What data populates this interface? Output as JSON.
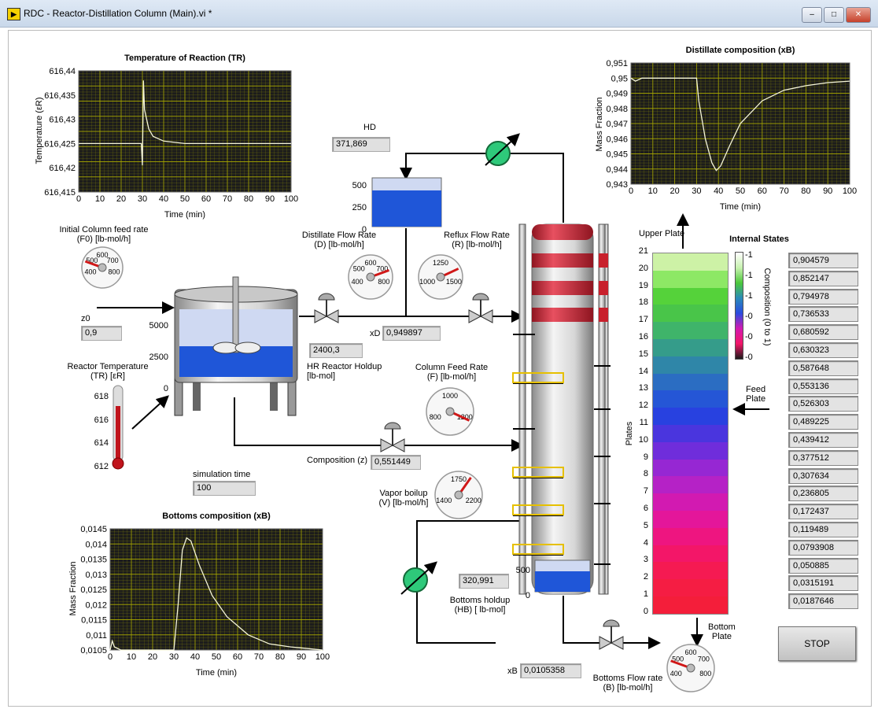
{
  "window": {
    "title": "RDC - Reactor-Distillation Column (Main).vi *",
    "icon_text": "▶",
    "minimize": "–",
    "maximize": "□",
    "close": "✕"
  },
  "charts": {
    "tr": {
      "title": "Temperature of Reaction (TR)",
      "ylabel": "Temperature (εR)",
      "xlabel": "Time (min)",
      "yticks": [
        "616,44",
        "616,435",
        "616,43",
        "616,425",
        "616,42",
        "616,415"
      ],
      "xticks": [
        "0",
        "10",
        "20",
        "30",
        "40",
        "50",
        "60",
        "70",
        "80",
        "90",
        "100"
      ]
    },
    "xd": {
      "title": "Distillate composition (xB)",
      "ylabel": "Mass Fraction",
      "xlabel": "Time (min)",
      "yticks": [
        "0,951",
        "0,95",
        "0,949",
        "0,948",
        "0,947",
        "0,946",
        "0,945",
        "0,944",
        "0,943"
      ],
      "xticks": [
        "0",
        "10",
        "20",
        "30",
        "40",
        "50",
        "60",
        "70",
        "80",
        "90",
        "100"
      ]
    },
    "xb": {
      "title": "Bottoms composition (xB)",
      "ylabel": "Mass Fraction",
      "xlabel": "Time (min)",
      "yticks": [
        "0,0145",
        "0,014",
        "0,0135",
        "0,013",
        "0,0125",
        "0,012",
        "0,0115",
        "0,011",
        "0,0105"
      ],
      "xticks": [
        "0",
        "10",
        "20",
        "30",
        "40",
        "50",
        "60",
        "70",
        "80",
        "90",
        "100"
      ]
    }
  },
  "chart_data": [
    {
      "type": "line",
      "title": "Temperature of Reaction (TR)",
      "xlabel": "Time (min)",
      "ylabel": "Temperature (εR)",
      "xlim": [
        0,
        100
      ],
      "ylim": [
        616.415,
        616.44
      ],
      "grid": true,
      "series": [
        {
          "x": [
            0,
            10,
            20,
            29.5,
            30,
            30.5,
            31,
            33,
            35,
            40,
            50,
            60,
            70,
            80,
            90,
            100
          ],
          "values": [
            616.425,
            616.425,
            616.425,
            616.425,
            616.4205,
            616.438,
            616.432,
            616.428,
            616.4265,
            616.4255,
            616.425,
            616.425,
            616.425,
            616.425,
            616.425,
            616.425
          ]
        }
      ]
    },
    {
      "type": "line",
      "title": "Distillate composition (xB)",
      "xlabel": "Time (min)",
      "ylabel": "Mass Fraction",
      "xlim": [
        0,
        100
      ],
      "ylim": [
        0.943,
        0.951
      ],
      "grid": true,
      "series": [
        {
          "x": [
            0,
            2,
            5,
            10,
            20,
            30,
            31,
            34,
            37,
            39,
            41,
            45,
            50,
            60,
            70,
            80,
            90,
            100
          ],
          "values": [
            0.95,
            0.9498,
            0.95,
            0.95,
            0.95,
            0.95,
            0.9485,
            0.946,
            0.9444,
            0.9439,
            0.9442,
            0.9455,
            0.947,
            0.9485,
            0.9492,
            0.9495,
            0.9497,
            0.9498
          ]
        }
      ]
    },
    {
      "type": "line",
      "title": "Bottoms composition (xB)",
      "xlabel": "Time (min)",
      "ylabel": "Mass Fraction",
      "xlim": [
        0,
        100
      ],
      "ylim": [
        0.0105,
        0.0145
      ],
      "grid": true,
      "series": [
        {
          "x": [
            0,
            1,
            2,
            5,
            10,
            20,
            30,
            32,
            34,
            36,
            38,
            42,
            48,
            55,
            65,
            75,
            85,
            100
          ],
          "values": [
            0.0105,
            0.0108,
            0.0106,
            0.0105,
            0.0105,
            0.0105,
            0.0105,
            0.012,
            0.0138,
            0.0142,
            0.0141,
            0.0133,
            0.0123,
            0.0116,
            0.011,
            0.0107,
            0.0106,
            0.0105
          ]
        }
      ]
    }
  ],
  "indicators": {
    "hd": {
      "label": "HD",
      "value": "371,869"
    },
    "z0": {
      "label": "z0",
      "value": "0,9"
    },
    "xd": {
      "label": "xD",
      "value": "0,949897"
    },
    "reactor_holdup": {
      "label": "HR Reactor Holdup\n[lb-mol]",
      "value": "2400,3"
    },
    "composition_z": {
      "label": "Composition (z)",
      "value": "0,551449"
    },
    "sim_time": {
      "label": "simulation time",
      "value": "100"
    },
    "bottoms_holdup": {
      "label": "Bottoms holdup\n(HB) [ lb-mol]",
      "value": "320,991"
    },
    "xb": {
      "label": "xB",
      "value": "0,0105358"
    }
  },
  "gauges": {
    "f0": {
      "label": "Initial Column feed rate\n(F0) [lb-mol/h]",
      "ticks": [
        "400",
        "500",
        "600",
        "700",
        "800"
      ]
    },
    "d": {
      "label": "Distillate Flow Rate\n(D) [lb-mol/h]",
      "ticks": [
        "400",
        "500",
        "600",
        "700",
        "800"
      ]
    },
    "r": {
      "label": "Reflux Flow Rate\n(R) [lb-mol/h]",
      "ticks": [
        "1000",
        "1250",
        "1500"
      ]
    },
    "f": {
      "label": "Column Feed Rate\n(F) [lb-mol/h]",
      "ticks": [
        "800",
        "1000",
        "1200"
      ]
    },
    "v": {
      "label": "Vapor boilup\n(V) [lb-mol/h]",
      "ticks": [
        "1400",
        "1750",
        "2200"
      ]
    },
    "b": {
      "label": "Bottoms Flow rate\n(B) [lb-mol/h]",
      "ticks": [
        "400",
        "500",
        "600",
        "700",
        "800"
      ]
    }
  },
  "tanks": {
    "distillate": {
      "ticks": [
        "500",
        "250",
        "0"
      ],
      "level": 0.74
    },
    "reactor": {
      "label": "",
      "ticks": [
        "5000",
        "2500",
        "0"
      ],
      "level": 0.48
    },
    "bottoms": {
      "ticks": [
        "500",
        "0"
      ],
      "level": 0.64
    }
  },
  "thermometer": {
    "label": "Reactor Temperature\n(TR) [εR]",
    "ticks": [
      "618",
      "616",
      "614",
      "612"
    ],
    "level": 0.72
  },
  "heatmap": {
    "title": "Internal States",
    "ylabel": "Plates",
    "scale_label": "Composition (0 to 1)",
    "upper": "Upper Plate",
    "feed": "Feed\nPlate",
    "bottom": "Bottom\nPlate",
    "yticks": [
      "21",
      "20",
      "19",
      "18",
      "17",
      "16",
      "15",
      "14",
      "13",
      "12",
      "11",
      "10",
      "9",
      "8",
      "7",
      "6",
      "5",
      "4",
      "3",
      "2",
      "1",
      "0"
    ],
    "scale_ticks": [
      "1",
      "1",
      "1",
      "0",
      "0",
      "0"
    ],
    "colors": [
      "#cdf2a6",
      "#8de865",
      "#55d23a",
      "#49c549",
      "#3fb46a",
      "#359c8a",
      "#2f86a8",
      "#2b6dc2",
      "#2556d6",
      "#2841e0",
      "#4a35de",
      "#6f2ddb",
      "#9627d3",
      "#b522c6",
      "#d21ab1",
      "#e4169a",
      "#ee1580",
      "#f31668",
      "#f51a52",
      "#f51d43",
      "#f41e3a"
    ]
  },
  "states": {
    "values": [
      "0,904579",
      "0,852147",
      "0,794978",
      "0,736533",
      "0,680592",
      "0,630323",
      "0,587648",
      "0,553136",
      "0,526303",
      "0,489225",
      "0,439412",
      "0,377512",
      "0,307634",
      "0,236805",
      "0,172437",
      "0,119489",
      "0,0793908",
      "0,050885",
      "0,0315191",
      "0,0187646"
    ]
  },
  "buttons": {
    "stop": "STOP"
  },
  "colors": {
    "plot_bg": "#1c1c1c",
    "grid": "#a8a800",
    "trace": "#f5f5d8",
    "pipe": "#000000",
    "stripe": "#c8202c",
    "tray": "#f0d000",
    "pump": "#2ec97a"
  }
}
